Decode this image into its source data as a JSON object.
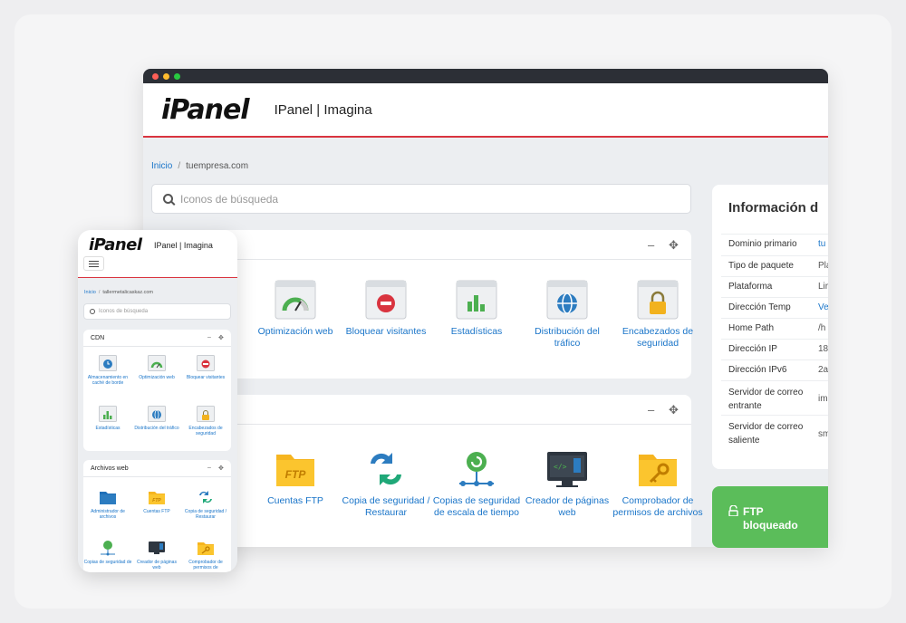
{
  "desktop": {
    "brand_title": "IPanel | Imagina",
    "logo_text": "iPanel",
    "breadcrumb": {
      "home": "Inicio",
      "separator": "/",
      "current": "tuempresa.com"
    },
    "search": {
      "placeholder": "Iconos de búsqueda"
    },
    "panel1_tiles": [
      {
        "label": "Optimización web",
        "icon": "speedometer-icon"
      },
      {
        "label": "Bloquear visitantes",
        "icon": "block-icon"
      },
      {
        "label": "Estadísticas",
        "icon": "bar-chart-icon"
      },
      {
        "label": "Distribución del tráfico",
        "icon": "globe-icon"
      },
      {
        "label": "Encabezados de seguridad",
        "icon": "lock-icon"
      }
    ],
    "panel2_tiles": [
      {
        "label": "Cuentas FTP",
        "icon": "ftp-folder-icon"
      },
      {
        "label": "Copia de seguridad / Restaurar",
        "icon": "backup-restore-icon"
      },
      {
        "label": "Copias de seguridad de escala de tiempo",
        "icon": "timeline-backup-icon"
      },
      {
        "label": "Creador de páginas web",
        "icon": "page-builder-icon"
      },
      {
        "label": "Comprobador de permisos de archivos",
        "icon": "key-folder-icon"
      }
    ],
    "panel_controls": {
      "minimize": "–",
      "move": "✥"
    },
    "info": {
      "title": "Información d",
      "rows": [
        {
          "label": "Dominio primario",
          "value": "tu"
        },
        {
          "label": "Tipo de paquete",
          "value": "Pla"
        },
        {
          "label": "Plataforma",
          "value": "Lir"
        },
        {
          "label": "Dirección Temp",
          "value": "Ve"
        },
        {
          "label": "Home Path",
          "value": "/h"
        },
        {
          "label": "Dirección IP",
          "value": "18"
        },
        {
          "label": "Dirección IPv6",
          "value": "2a"
        },
        {
          "label": "Servidor de correo entrante",
          "value": "im"
        },
        {
          "label": "Servidor de correo saliente",
          "value": "sm"
        }
      ]
    },
    "ftp_badge": "FTP bloqueado"
  },
  "mobile": {
    "logo_text": "iPanel",
    "brand_title": "IPanel | Imagina",
    "breadcrumb": {
      "home": "Inicio",
      "separator": "/",
      "current": "tallermetalicaskaz.com"
    },
    "search": {
      "placeholder": "Iconos de búsqueda"
    },
    "cdn": {
      "title": "CDN",
      "tiles": [
        {
          "label": "Almacenamiento en caché de borde",
          "icon": "clock-cache-icon"
        },
        {
          "label": "Optimización web",
          "icon": "speedometer-icon"
        },
        {
          "label": "Bloquear visitantes",
          "icon": "block-icon"
        },
        {
          "label": "Estadísticas",
          "icon": "bar-chart-icon"
        },
        {
          "label": "Distribución del tráfico",
          "icon": "globe-icon"
        },
        {
          "label": "Encabezados de seguridad",
          "icon": "lock-icon"
        }
      ]
    },
    "files": {
      "title": "Archivos web",
      "tiles": [
        {
          "label": "Administrador de archivos",
          "icon": "file-manager-icon"
        },
        {
          "label": "Cuentas FTP",
          "icon": "ftp-folder-icon"
        },
        {
          "label": "Copia de seguridad / Restaurar",
          "icon": "backup-restore-icon"
        },
        {
          "label": "Copias de seguridad de",
          "icon": "timeline-backup-icon"
        },
        {
          "label": "Creador de páginas web",
          "icon": "page-builder-icon"
        },
        {
          "label": "Comprobador de permisos de",
          "icon": "key-folder-icon"
        }
      ]
    }
  },
  "colors": {
    "accent_red": "#d9343f",
    "link_blue": "#1a75c9",
    "ftp_green": "#5bbd5a"
  }
}
